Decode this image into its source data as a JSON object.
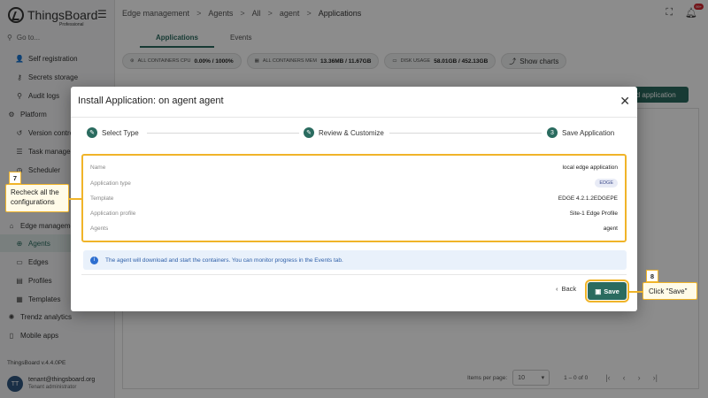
{
  "app": {
    "logo": "ThingsBoard",
    "logo_sub": "Professional",
    "goto_placeholder": "Go to...",
    "version": "ThingsBoard v.4.4.0PE"
  },
  "sidebar": {
    "items": [
      {
        "label": "Self registration",
        "icon": "person-add-icon"
      },
      {
        "label": "Secrets storage",
        "icon": "key-icon"
      },
      {
        "label": "Audit logs",
        "icon": "search-icon"
      },
      {
        "label": "Platform",
        "icon": "settings-icon"
      },
      {
        "label": "Version control",
        "icon": "history-icon"
      },
      {
        "label": "Task manager",
        "icon": "tasks-icon"
      },
      {
        "label": "Scheduler",
        "icon": "clock-icon"
      },
      {
        "label": "Edge management",
        "icon": "router-icon"
      },
      {
        "label": "Agents",
        "icon": "agent-icon"
      },
      {
        "label": "Edges",
        "icon": "edges-icon"
      },
      {
        "label": "Profiles",
        "icon": "profile-icon"
      },
      {
        "label": "Templates",
        "icon": "template-icon"
      },
      {
        "label": "Trendz analytics",
        "icon": "trendz-icon"
      },
      {
        "label": "Mobile apps",
        "icon": "phone-icon"
      }
    ]
  },
  "user": {
    "initials": "TT",
    "email": "tenant@thingsboard.org",
    "role": "Tenant administrator"
  },
  "breadcrumb": [
    "Edge management",
    "Agents",
    "All",
    "agent",
    "Applications"
  ],
  "topbar": {
    "notification_count": "99+"
  },
  "tabs": [
    "Applications",
    "Events"
  ],
  "stats": [
    {
      "label": "ALL CONTAINERS CPU",
      "value": "0.00% / 1000%"
    },
    {
      "label": "ALL CONTAINERS MEM",
      "value": "13.36MB / 11.67GB"
    },
    {
      "label": "DISK USAGE",
      "value": "58.01GB / 452.13GB"
    }
  ],
  "show_charts": "Show charts",
  "add_application": "dd application",
  "pager": {
    "label": "Items per page:",
    "per_page": "10",
    "range": "1 – 0 of 0"
  },
  "dialog": {
    "title": "Install Application: on agent agent",
    "steps": [
      {
        "num": "✎",
        "label": "Select Type"
      },
      {
        "num": "✎",
        "label": "Review & Customize"
      },
      {
        "num": "3",
        "label": "Save Application"
      }
    ],
    "summary": [
      {
        "label": "Name",
        "value": "local edge application"
      },
      {
        "label": "Application type",
        "value": "EDGE"
      },
      {
        "label": "Template",
        "value": "EDGE 4.2.1.2EDGEPE"
      },
      {
        "label": "Application profile",
        "value": "Site-1 Edge Profile"
      },
      {
        "label": "Agents",
        "value": "agent"
      }
    ],
    "info": "The agent will download and start the containers. You can monitor progress in the Events tab.",
    "back": "Back",
    "save": "Save"
  },
  "callouts": {
    "step7_num": "7",
    "step7_text": "Recheck all the configurations",
    "step8_num": "8",
    "step8_text": "Click \"Save\""
  },
  "colors": {
    "accent": "#2a6b5f",
    "highlight": "#f0b429"
  }
}
